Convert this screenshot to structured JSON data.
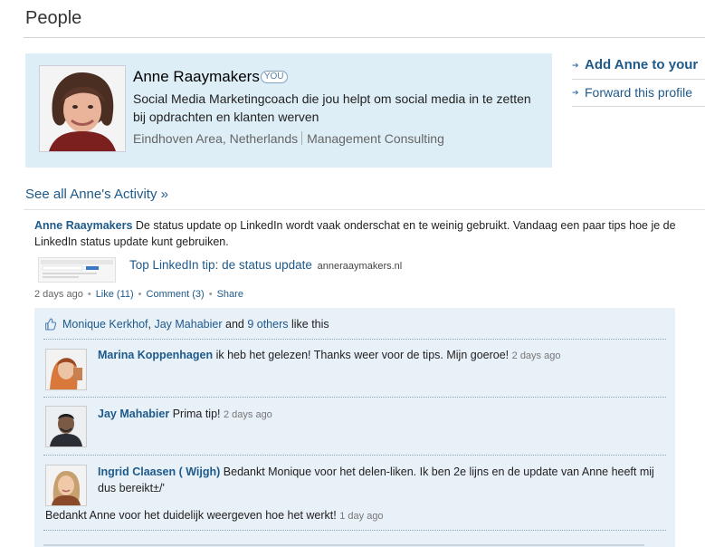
{
  "page": {
    "title": "People"
  },
  "profile": {
    "name": "Anne Raaymakers",
    "you_badge": "YOU",
    "headline": "Social Media Marketingcoach die jou helpt om social media in te zetten bij opdrachten en klanten werven",
    "location": "Eindhoven Area, Netherlands",
    "industry": "Management Consulting"
  },
  "side_actions": [
    {
      "label": "Add Anne to your"
    },
    {
      "label": "Forward this profile"
    }
  ],
  "activity": {
    "see_all": "See all Anne's Activity »",
    "update": {
      "author": "Anne Raaymakers",
      "text": "De status update op LinkedIn wordt vaak onderschat en te weinig gebruikt. Vandaag een paar tips hoe je de LinkedIn status update kunt gebruiken.",
      "share_title": "Top LinkedIn tip: de status update",
      "share_domain": "anneraaymakers.nl",
      "time": "2 days ago",
      "like": "Like (11)",
      "comment": "Comment (3)",
      "share": "Share"
    },
    "likes": {
      "person1": "Monique Kerkhof",
      "sep1": ", ",
      "person2": "Jay Mahabier",
      "and": " and ",
      "others": "9 others",
      "suffix": " like this"
    },
    "comments": [
      {
        "name": "Marina Koppenhagen",
        "text": "ik heb het gelezen! Thanks weer voor de tips. Mijn goeroe!",
        "time": "2 days ago"
      },
      {
        "name": "Jay Mahabier",
        "text": "Prima tip!",
        "time": "2 days ago"
      },
      {
        "name": "Ingrid Claasen ( Wijgh)",
        "text": "Bedankt Monique voor het delen-liken. Ik ben 2e lijns en de update van Anne heeft mij dus bereikt±/'",
        "text2": "Bedankt Anne voor het duidelijk weergeven hoe het werkt!",
        "time": "1 day ago"
      }
    ]
  }
}
